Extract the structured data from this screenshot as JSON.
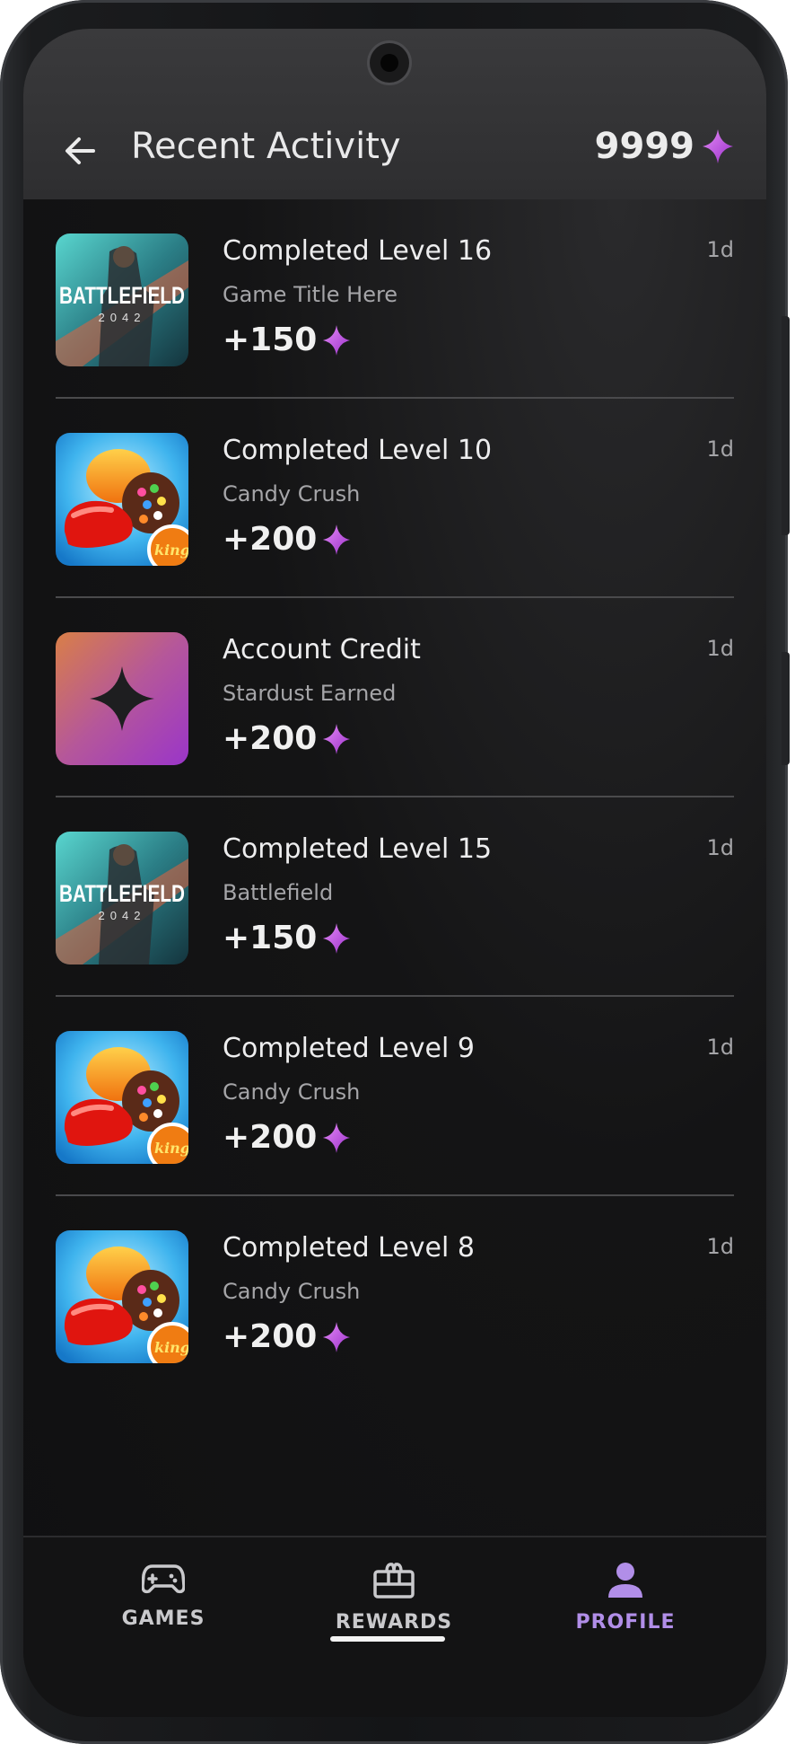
{
  "header": {
    "title": "Recent Activity",
    "balance": "9999",
    "back_icon": "arrow-left-icon",
    "currency_icon": "stardust-sparkle-icon"
  },
  "colors": {
    "accent": "#b84ad8",
    "profile_active": "#b18ee8",
    "nav_inactive": "#c9c9cc"
  },
  "activity": [
    {
      "title": "Completed Level 16",
      "subtitle": "Game Title Here",
      "time": "1d",
      "reward": "+150",
      "thumb": "battlefield"
    },
    {
      "title": "Completed Level 10",
      "subtitle": "Candy Crush",
      "time": "1d",
      "reward": "+200",
      "thumb": "candy"
    },
    {
      "title": "Account Credit",
      "subtitle": "Stardust Earned",
      "time": "1d",
      "reward": "+200",
      "thumb": "credit"
    },
    {
      "title": "Completed Level 15",
      "subtitle": "Battlefield",
      "time": "1d",
      "reward": "+150",
      "thumb": "battlefield"
    },
    {
      "title": "Completed Level 9",
      "subtitle": "Candy Crush",
      "time": "1d",
      "reward": "+200",
      "thumb": "candy"
    },
    {
      "title": "Completed Level 8",
      "subtitle": "Candy Crush",
      "time": "1d",
      "reward": "+200",
      "thumb": "candy"
    }
  ],
  "thumbs": {
    "battlefield_title": "BATTLEFIELD",
    "battlefield_year": "2042",
    "candy_badge": "king"
  },
  "nav": {
    "games": "GAMES",
    "rewards": "REWARDS",
    "profile": "PROFILE",
    "active": "profile"
  }
}
